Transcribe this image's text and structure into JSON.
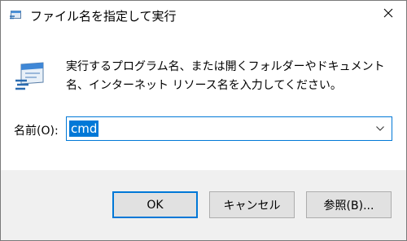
{
  "window": {
    "title": "ファイル名を指定して実行",
    "icon": "run-icon",
    "close_icon": "close-icon"
  },
  "content": {
    "description": "実行するプログラム名、または開くフォルダーやドキュメント名、インターネット リソース名を入力してください。",
    "open_label": "名前(O):",
    "open_value": "cmd"
  },
  "buttons": {
    "ok": "OK",
    "cancel": "キャンセル",
    "browse": "参照(B)..."
  },
  "colors": {
    "accent": "#0078d7",
    "footer_bg": "#f0f0f0",
    "button_bg": "#e1e1e1"
  }
}
